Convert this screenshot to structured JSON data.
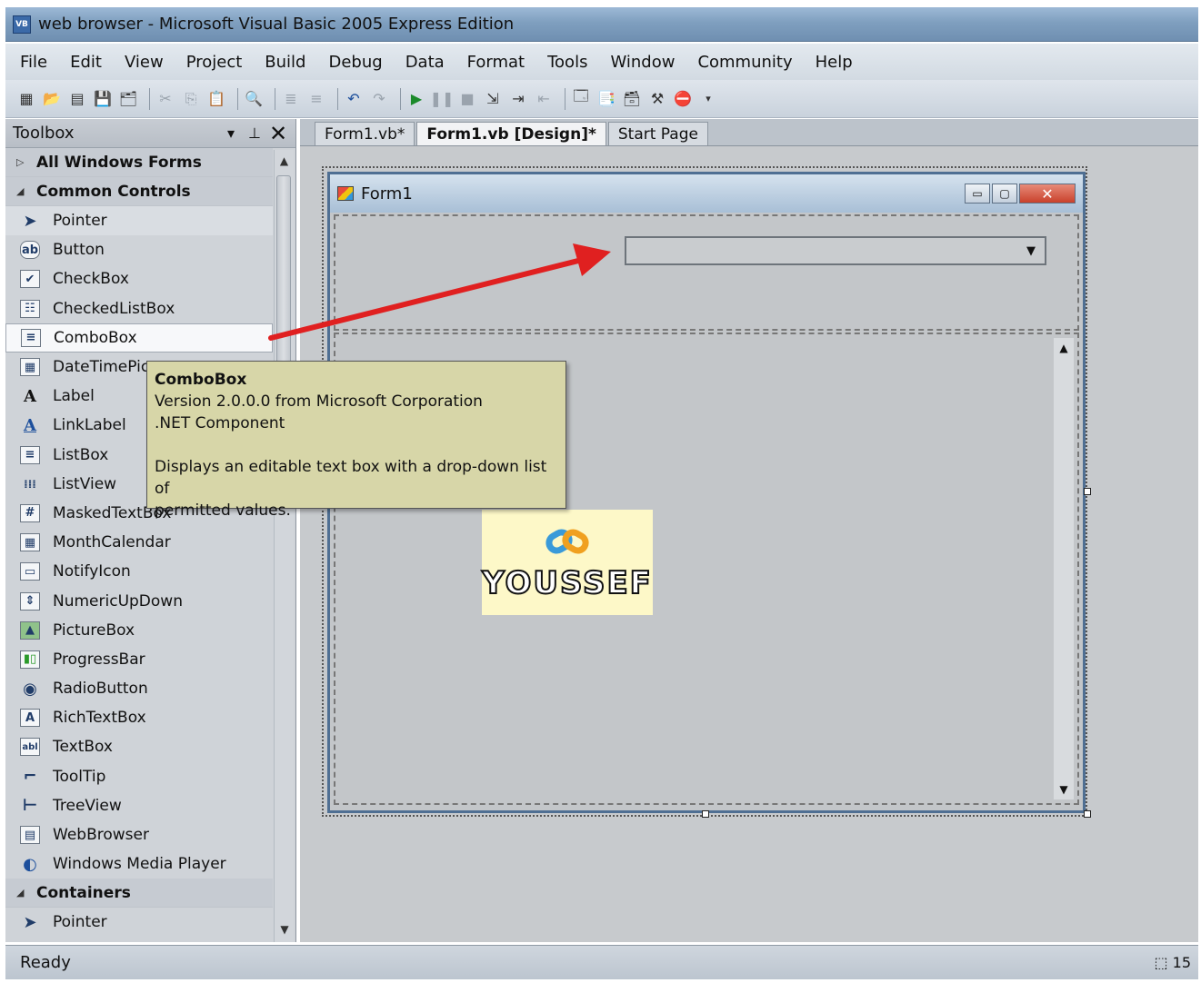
{
  "window": {
    "title": "web browser - Microsoft Visual Basic 2005 Express Edition",
    "icon": "VB"
  },
  "menu": [
    "File",
    "Edit",
    "View",
    "Project",
    "Build",
    "Debug",
    "Data",
    "Format",
    "Tools",
    "Window",
    "Community",
    "Help"
  ],
  "toolbox": {
    "title": "Toolbox",
    "groups": {
      "all": "All Windows Forms",
      "common": "Common Controls",
      "containers": "Containers"
    },
    "items": [
      {
        "label": "Pointer",
        "icon": "pointer-icon"
      },
      {
        "label": "Button",
        "icon": "button-icon"
      },
      {
        "label": "CheckBox",
        "icon": "checkbox-icon"
      },
      {
        "label": "CheckedListBox",
        "icon": "checkedlistbox-icon"
      },
      {
        "label": "ComboBox",
        "icon": "combobox-icon"
      },
      {
        "label": "DateTimePic",
        "icon": "datetimepicker-icon"
      },
      {
        "label": "Label",
        "icon": "label-icon"
      },
      {
        "label": "LinkLabel",
        "icon": "linklabel-icon"
      },
      {
        "label": "ListBox",
        "icon": "listbox-icon"
      },
      {
        "label": "ListView",
        "icon": "listview-icon"
      },
      {
        "label": "MaskedTextBox",
        "icon": "maskedtextbox-icon"
      },
      {
        "label": "MonthCalendar",
        "icon": "monthcalendar-icon"
      },
      {
        "label": "NotifyIcon",
        "icon": "notifyicon-icon"
      },
      {
        "label": "NumericUpDown",
        "icon": "numericupdown-icon"
      },
      {
        "label": "PictureBox",
        "icon": "picturebox-icon"
      },
      {
        "label": "ProgressBar",
        "icon": "progressbar-icon"
      },
      {
        "label": "RadioButton",
        "icon": "radiobutton-icon"
      },
      {
        "label": "RichTextBox",
        "icon": "richtextbox-icon"
      },
      {
        "label": "TextBox",
        "icon": "textbox-icon"
      },
      {
        "label": "ToolTip",
        "icon": "tooltip-icon"
      },
      {
        "label": "TreeView",
        "icon": "treeview-icon"
      },
      {
        "label": "WebBrowser",
        "icon": "webbrowser-icon"
      },
      {
        "label": "Windows Media Player",
        "icon": "mediaplayer-icon"
      }
    ],
    "containers_first": "Pointer"
  },
  "tabs": [
    "Form1.vb*",
    "Form1.vb [Design]*",
    "Start Page"
  ],
  "form": {
    "title": "Form1"
  },
  "tooltip": {
    "title": "ComboBox",
    "line1": "Version 2.0.0.0 from Microsoft Corporation",
    "line2": ".NET Component",
    "line3": "Displays an editable text box with a drop-down list of",
    "line4": "permitted values."
  },
  "logo": {
    "text": "YOUSSEF"
  },
  "status": {
    "text": "Ready",
    "right": "15"
  },
  "colors": {
    "arrow": "#e02020",
    "tooltip_bg": "#d7d6a8"
  }
}
